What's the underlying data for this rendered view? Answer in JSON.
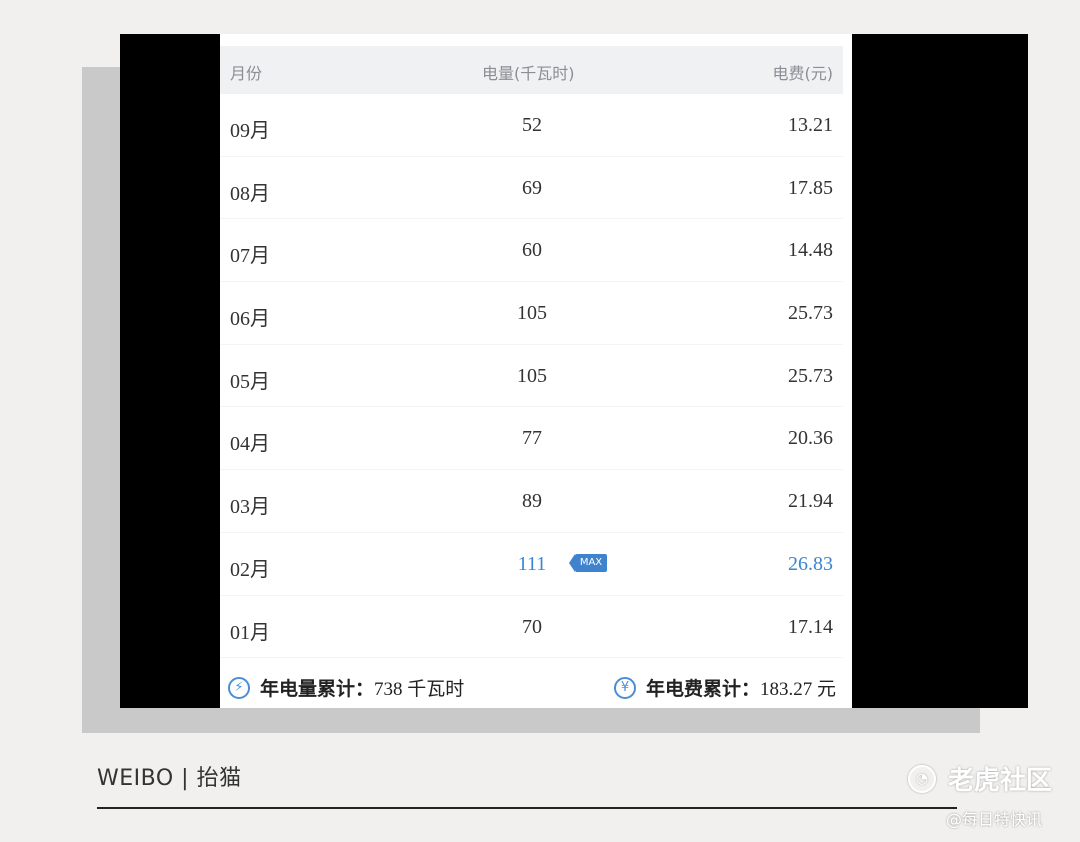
{
  "table": {
    "headers": {
      "month": "月份",
      "kwh": "电量(千瓦时)",
      "fee": "电费(元)"
    },
    "rows": [
      {
        "month": "09月",
        "kwh": "52",
        "fee": "13.21"
      },
      {
        "month": "08月",
        "kwh": "69",
        "fee": "17.85"
      },
      {
        "month": "07月",
        "kwh": "60",
        "fee": "14.48"
      },
      {
        "month": "06月",
        "kwh": "105",
        "fee": "25.73"
      },
      {
        "month": "05月",
        "kwh": "105",
        "fee": "25.73"
      },
      {
        "month": "04月",
        "kwh": "77",
        "fee": "20.36"
      },
      {
        "month": "03月",
        "kwh": "89",
        "fee": "21.94"
      },
      {
        "month": "02月",
        "kwh": "111",
        "fee": "26.83",
        "badge": "MAX"
      },
      {
        "month": "01月",
        "kwh": "70",
        "fee": "17.14"
      }
    ]
  },
  "summary": {
    "kwh_label": "年电量累计：",
    "kwh_value": "738 千瓦时",
    "fee_label": "年电费累计：",
    "fee_value": "183.27 元",
    "kwh_icon": "lightning-icon",
    "fee_icon": "yuan-icon"
  },
  "footer": {
    "credit": "WEIBO | 抬猫"
  },
  "watermark": {
    "brand": "老虎社区",
    "sub": "@每日特快讯"
  },
  "colors": {
    "accent": "#3a86d0",
    "header_bg": "#eff1f2"
  }
}
